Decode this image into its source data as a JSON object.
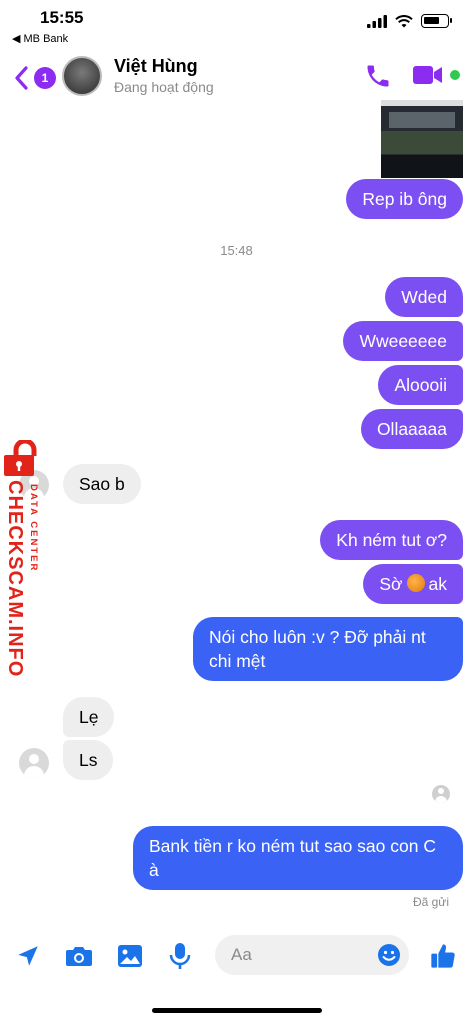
{
  "status_bar": {
    "time": "15:55",
    "back_app": "◀ MB Bank"
  },
  "header": {
    "badge": "1",
    "name": "Việt Hùng",
    "status": "Đang hoạt động"
  },
  "messages": {
    "m1": "Rep ib ông",
    "time1": "15:48",
    "m2": "Wded",
    "m3": "Wweeeeee",
    "m4": "Aloooii",
    "m5": "Ollaaaaa",
    "m6": "Sao b",
    "m7": "Kh ném tut ơ?",
    "m8a": "Sờ",
    "m8b": "ak",
    "m9": "Nói cho luôn :v ? Đỡ phải nt chi mệt",
    "m10": "Lẹ",
    "m11": "Ls",
    "m12": "Bank tiền r ko ném tut sao sao con C à",
    "sent": "Đã gửi"
  },
  "watermark": {
    "brand": "CHECKSCAM.INFO",
    "sub": "DATA CENTER"
  },
  "composer": {
    "placeholder": "Aa"
  },
  "colors": {
    "accent": "#8c2cf1",
    "bubble_purple": "#7c4ff2",
    "bubble_blue": "#3a63f5",
    "toolbar_blue": "#1a73e8",
    "online": "#31c950"
  }
}
